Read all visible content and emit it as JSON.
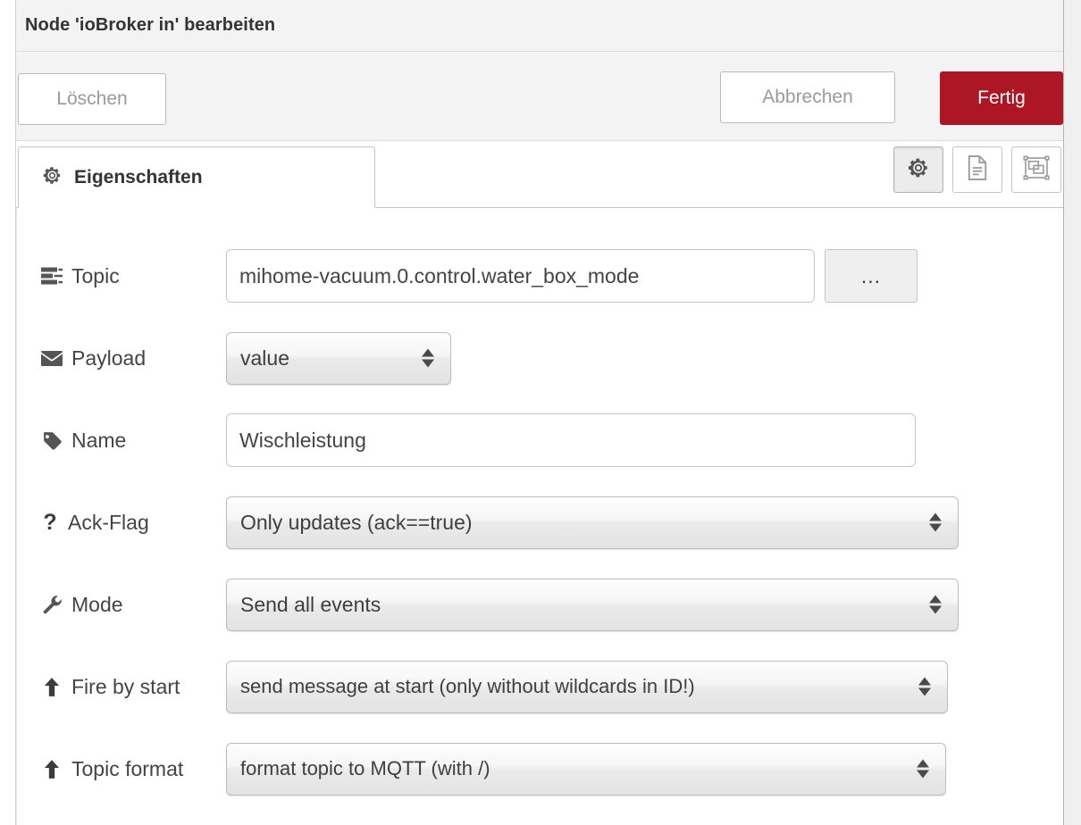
{
  "dialog": {
    "title": "Node 'ioBroker in' bearbeiten"
  },
  "actions": {
    "delete_label": "Löschen",
    "cancel_label": "Abbrechen",
    "done_label": "Fertig",
    "done_color": "#ad1625"
  },
  "tabs": [
    {
      "label": "Eigenschaften",
      "icon": "gear-icon",
      "active": true
    }
  ],
  "tab_icon_buttons": [
    {
      "icon": "gear-icon",
      "name": "properties-view-button",
      "active": true
    },
    {
      "icon": "description-icon",
      "name": "description-view-button",
      "active": false
    },
    {
      "icon": "appearance-icon",
      "name": "appearance-view-button",
      "active": false
    }
  ],
  "form": {
    "rows": [
      {
        "key": "topic",
        "icon": "tasks-icon",
        "label": "Topic",
        "control": "text",
        "value": "mihome-vacuum.0.control.water_box_mode",
        "placeholder": "",
        "extra_button": "..."
      },
      {
        "key": "payload",
        "icon": "envelope-icon",
        "label": "Payload",
        "control": "select",
        "value": "value"
      },
      {
        "key": "name",
        "icon": "tag-icon",
        "label": "Name",
        "control": "text",
        "value": "Wischleistung",
        "placeholder": ""
      },
      {
        "key": "ack_flag",
        "icon": "question-icon",
        "label": "Ack-Flag",
        "control": "select",
        "value": "Only updates (ack==true)"
      },
      {
        "key": "mode",
        "icon": "wrench-icon",
        "label": "Mode",
        "control": "select",
        "value": "Send all events"
      },
      {
        "key": "fire_by_start",
        "icon": "arrow-up-icon",
        "label": "Fire by start",
        "control": "select",
        "value": "send message at start (only without wildcards in ID!)"
      },
      {
        "key": "topic_format",
        "icon": "arrow-up-icon",
        "label": "Topic format",
        "control": "select",
        "value": "format topic to MQTT (with /)"
      }
    ]
  }
}
